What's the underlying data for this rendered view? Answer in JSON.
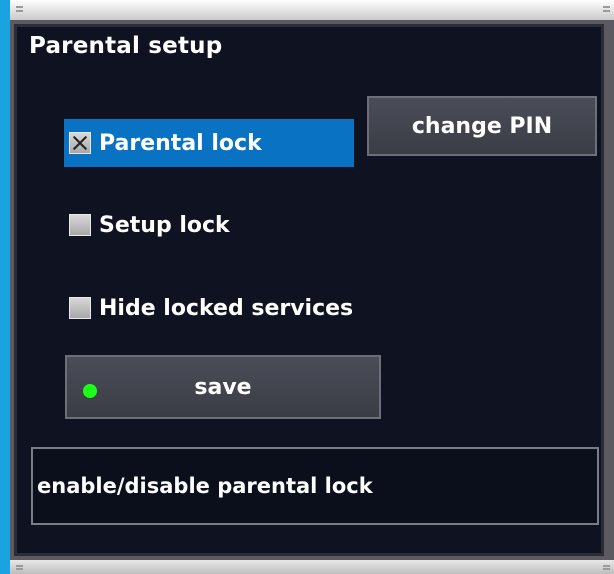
{
  "window": {
    "title": "Parental setup"
  },
  "options": [
    {
      "label": "Parental lock",
      "checked": true,
      "selected": true
    },
    {
      "label": "Setup lock",
      "checked": false,
      "selected": false
    },
    {
      "label": "Hide locked services",
      "checked": false,
      "selected": false
    }
  ],
  "buttons": {
    "change_pin": "change PIN",
    "save": "save",
    "save_indicator_color": "#19ff19"
  },
  "help": {
    "text": "enable/disable parental lock"
  },
  "colors": {
    "selection": "#0a72c2",
    "background": "#0e1221",
    "border": "#19a3e0"
  }
}
